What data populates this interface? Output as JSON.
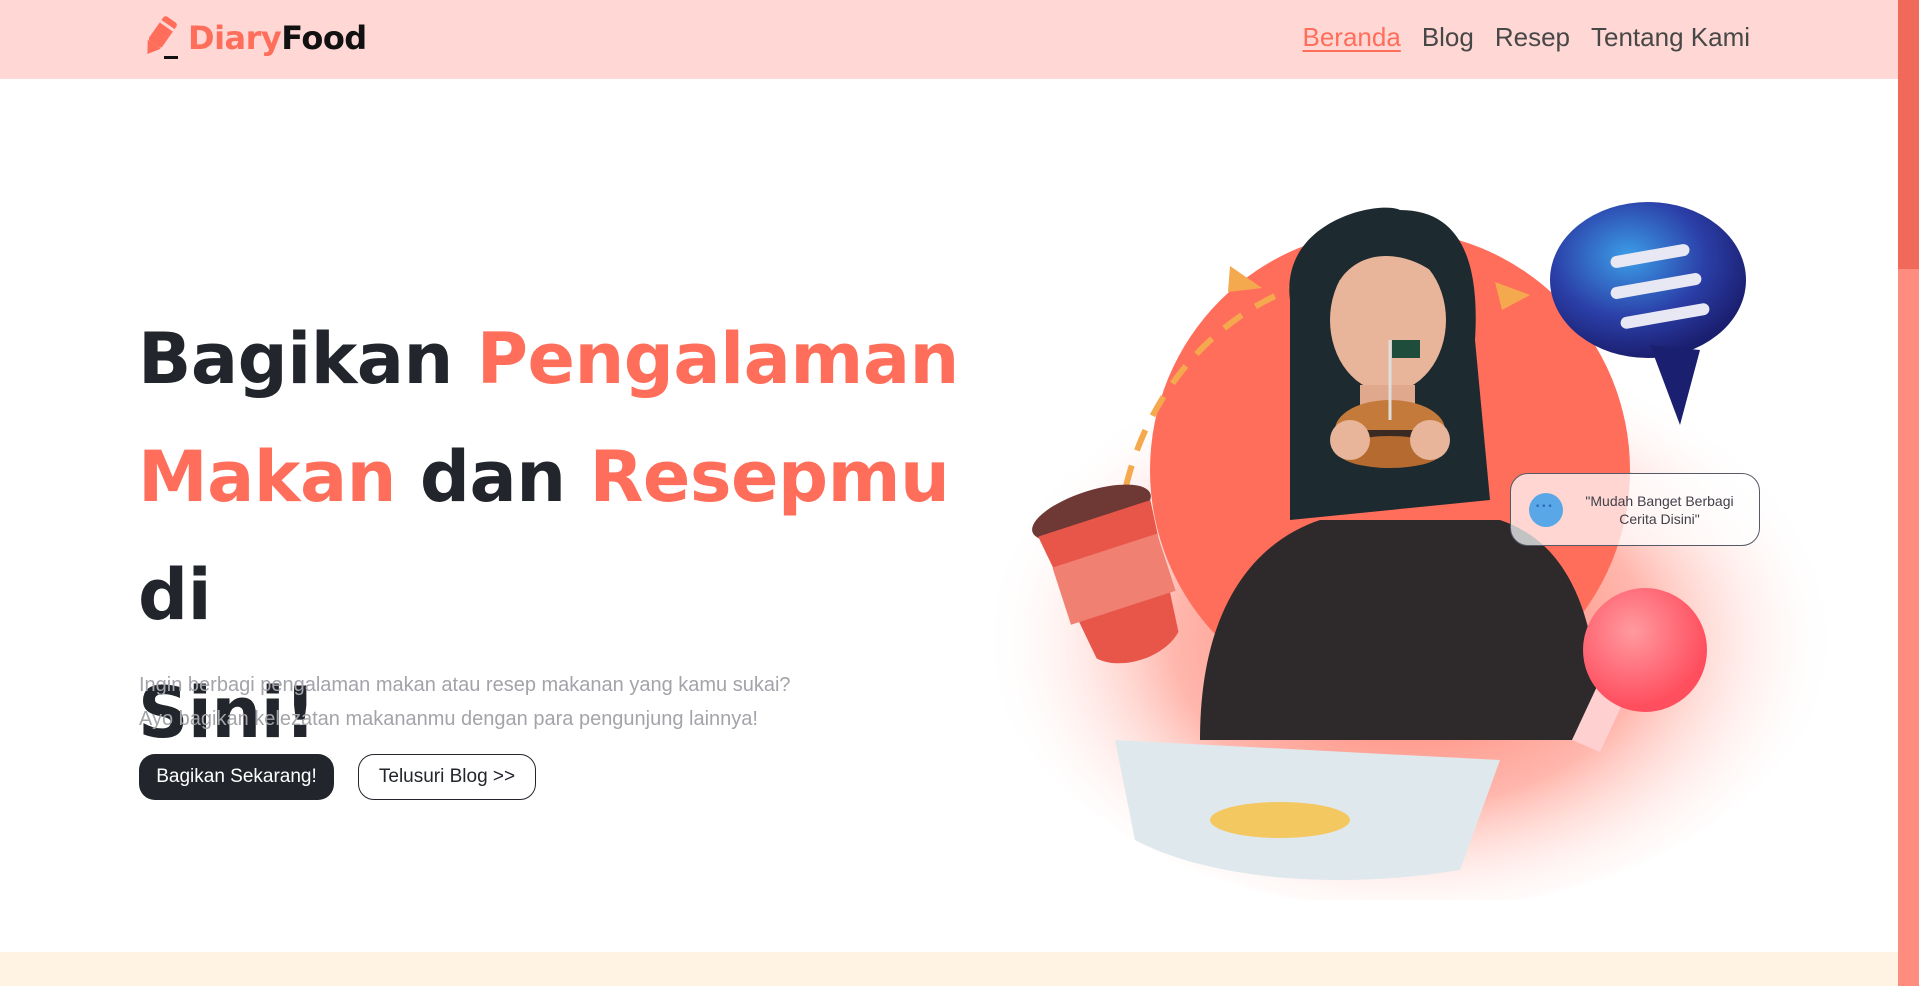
{
  "brand": {
    "part1": "Diary",
    "part2": "Food",
    "icon": "pencil-icon"
  },
  "nav": {
    "items": [
      {
        "label": "Beranda",
        "active": true
      },
      {
        "label": "Blog",
        "active": false
      },
      {
        "label": "Resep",
        "active": false
      },
      {
        "label": "Tentang Kami",
        "active": false
      }
    ]
  },
  "hero": {
    "title": {
      "w1": "Bagikan ",
      "w2": "Pengalaman",
      "w3": "Makan",
      "w4": " dan ",
      "w5": "Resepmu",
      "w6": " di",
      "w7": "Sini!"
    },
    "subtitle_line1": "Ingin berbagi pengalaman makan atau resep makanan yang kamu sukai?",
    "subtitle_line2": "Ayo bagikan kelezatan makananmu dengan para pengunjung lainnya!",
    "primary_button": "Bagikan Sekarang!",
    "secondary_button": "Telusuri Blog >>",
    "testimonial": "\"Mudah Banget Berbagi Cerita Disini\""
  },
  "colors": {
    "accent": "#ff6e5a",
    "dark": "#22252b",
    "navbar_bg": "#ffd8d6",
    "muted_text": "#a3a3aa",
    "band_bg": "#fff3e3"
  }
}
